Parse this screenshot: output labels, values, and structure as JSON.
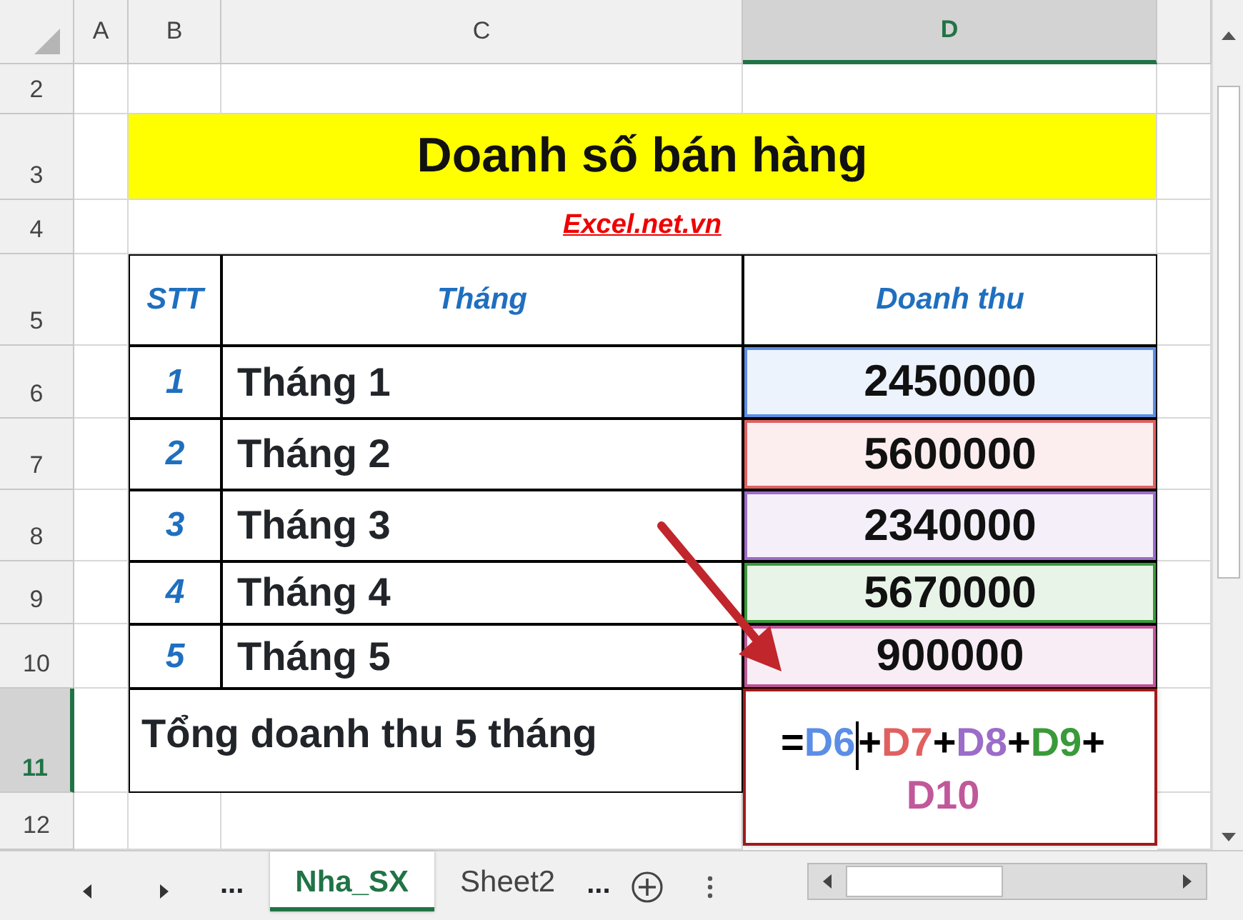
{
  "column_headers": [
    {
      "label": "A",
      "selected": false
    },
    {
      "label": "B",
      "selected": false
    },
    {
      "label": "C",
      "selected": false
    },
    {
      "label": "D",
      "selected": true
    }
  ],
  "row_headers": [
    {
      "label": "2",
      "selected": false
    },
    {
      "label": "3",
      "selected": false
    },
    {
      "label": "4",
      "selected": false
    },
    {
      "label": "5",
      "selected": false
    },
    {
      "label": "6",
      "selected": false
    },
    {
      "label": "7",
      "selected": false
    },
    {
      "label": "8",
      "selected": false
    },
    {
      "label": "9",
      "selected": false
    },
    {
      "label": "10",
      "selected": false
    },
    {
      "label": "11",
      "selected": true
    },
    {
      "label": "12",
      "selected": false
    }
  ],
  "title": "Doanh số bán hàng",
  "subtitle": "Excel.net.vn",
  "table": {
    "columns": [
      "STT",
      "Tháng",
      "Doanh thu"
    ],
    "rows": [
      {
        "stt": "1",
        "month": "Tháng 1",
        "revenue": "2450000",
        "color": "#5b8ee6"
      },
      {
        "stt": "2",
        "month": "Tháng 2",
        "revenue": "5600000",
        "color": "#e06060"
      },
      {
        "stt": "3",
        "month": "Tháng 3",
        "revenue": "2340000",
        "color": "#9b6cc9"
      },
      {
        "stt": "4",
        "month": "Tháng 4",
        "revenue": "5670000",
        "color": "#3a9a3a"
      },
      {
        "stt": "5",
        "month": "Tháng 5",
        "revenue": "900000",
        "color": "#c0589a"
      }
    ]
  },
  "total": {
    "label": "Tổng doanh thu 5 tháng",
    "formula": [
      {
        "text": "=",
        "color": "#000000",
        "caret": false
      },
      {
        "text": "D6",
        "color": "#5b8ee6",
        "caret": true
      },
      {
        "text": "+",
        "color": "#000000",
        "caret": false
      },
      {
        "text": "D7",
        "color": "#e06060",
        "caret": false
      },
      {
        "text": "+",
        "color": "#000000",
        "caret": false
      },
      {
        "text": "D8",
        "color": "#9b6cc9",
        "caret": false
      },
      {
        "text": "+",
        "color": "#000000",
        "caret": false
      },
      {
        "text": "D9",
        "color": "#3a9a3a",
        "caret": false
      },
      {
        "text": "+",
        "color": "#000000",
        "caret": false
      },
      {
        "text": "D10",
        "color": "#c0589a",
        "caret": false
      }
    ]
  },
  "sheet_nav": {
    "more_left": "...",
    "more_right": "..."
  },
  "sheet_tabs": [
    {
      "label": "Nha_SX",
      "selected": true
    },
    {
      "label": "Sheet2",
      "selected": false
    }
  ]
}
